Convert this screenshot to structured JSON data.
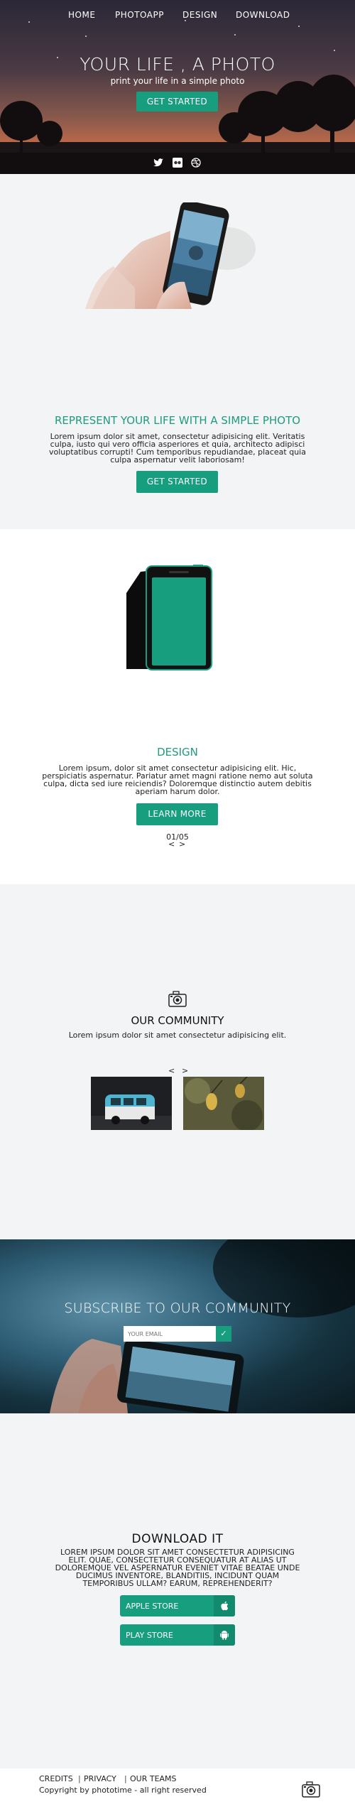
{
  "nav": {
    "items": [
      "HOME",
      "PHOTOAPP",
      "DESIGN",
      "DOWNLOAD"
    ]
  },
  "hero": {
    "title": "YOUR LIFE , A PHOTO",
    "subtitle": "print your life in a simple photo",
    "cta": "GET STARTED",
    "social": [
      "twitter-icon",
      "flickr-icon",
      "dribbble-icon"
    ]
  },
  "represent": {
    "title": "REPRESENT YOUR LIFE WITH A SIMPLE PHOTO",
    "lines": [
      "Lorem ipsum dolor sit amet, consectetur adipisicing elit. Veritatis",
      "culpa, iusto qui vero officia asperiores et quia, architecto adipisci",
      "voluptatibus corrupti! Cum temporibus repudiandae, placeat quia",
      "culpa aspernatur velit laboriosam!"
    ],
    "cta": "GET STARTED"
  },
  "design": {
    "title": "DESIGN",
    "lines": [
      "Lorem ipsum, dolor sit amet consectetur adipisicing elit. Hic,",
      "perspiciatis aspernatur. Pariatur amet magni ratione nemo aut soluta",
      "culpa, dicta sed iure reiciendis? Doloremque distinctio autem debitis",
      "aperiam harum dolor."
    ],
    "cta": "LEARN MORE",
    "pager": "01/05",
    "prev": "<",
    "next": ">"
  },
  "community": {
    "icon": "camera-icon",
    "title": "OUR COMMUNITY",
    "text": "Lorem ipsum dolor sit amet consectetur adipisicing elit.",
    "prev": "<",
    "next": ">"
  },
  "subscribe": {
    "title": "SUBSCRIBE TO OUR COMMUNITY",
    "placeholder": "YOUR EMAIL",
    "submit": "✓"
  },
  "download": {
    "title": "DOWNLOAD IT",
    "lines": [
      "LOREM IPSUM DOLOR SIT AMET CONSECTETUR ADIPISICING",
      "ELIT. QUAE, CONSECTETUR CONSEQUATUR AT ALIAS UT",
      "DOLOREMQUE VEL ASPERNATUR EVENIET VITAE BEATAE UNDE",
      "DUCIMUS INVENTORE, BLANDITIIS, INCIDUNT QUAM",
      "TEMPORIBUS ULLAM? EARUM, REPREHENDERIT?"
    ],
    "apple": "APPLE STORE",
    "play": "PLAY STORE"
  },
  "footer": {
    "links": [
      "CREDITS",
      "PRIVACY",
      "OUR TEAMS"
    ],
    "copyright": "Copyright by phototime - all right reserved",
    "icon": "camera-icon"
  },
  "colors": {
    "accent": "#169e7f",
    "accent_text": "#1f9b7f",
    "light_bg": "#f3f4f6"
  }
}
